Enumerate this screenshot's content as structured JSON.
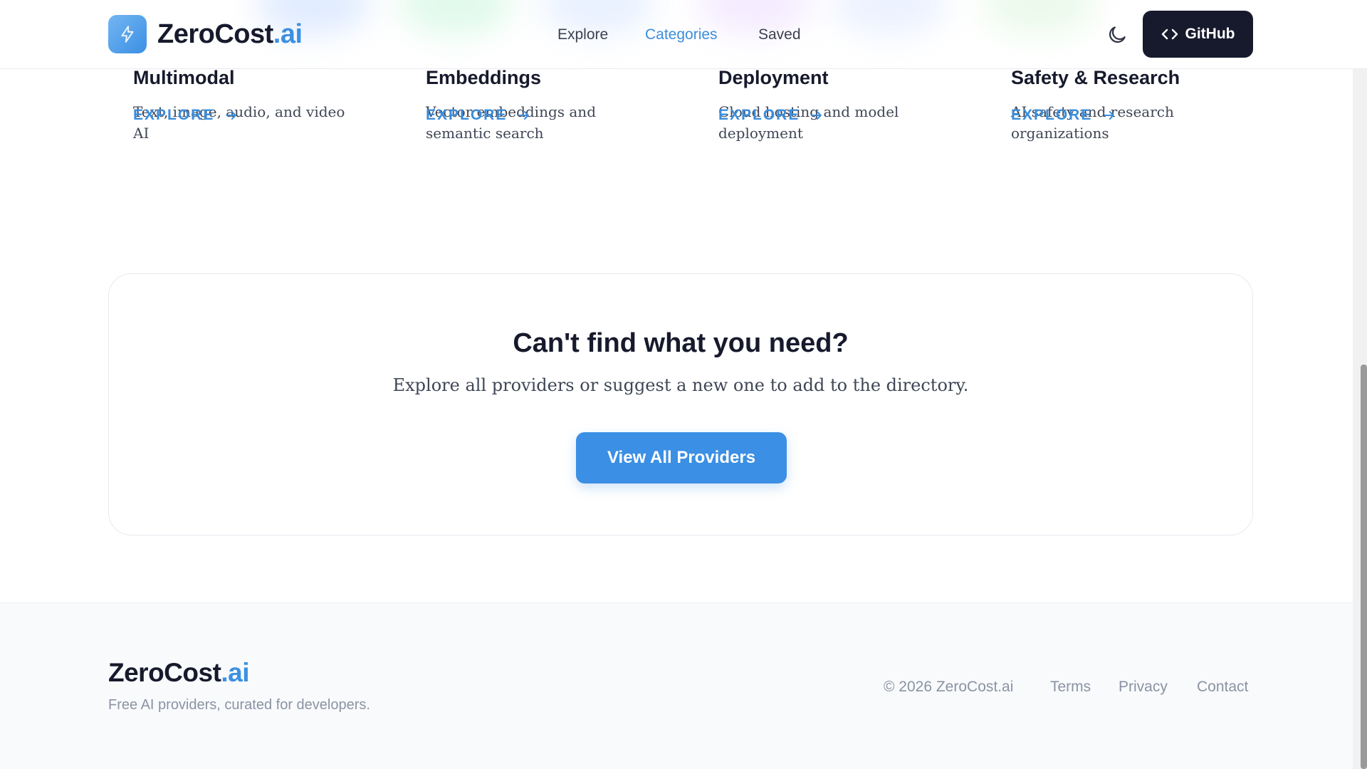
{
  "header": {
    "logo_main": "ZeroCost",
    "logo_accent": ".ai",
    "nav": [
      {
        "label": "Explore",
        "active": false
      },
      {
        "label": "Categories",
        "active": true
      },
      {
        "label": "Saved",
        "active": false
      }
    ],
    "theme_icon": "moon-icon",
    "github_label": "GitHub",
    "github_icon": "code-icon"
  },
  "categories": [
    {
      "title": "Multimodal",
      "description": "Text, image, audio, and video AI",
      "cta": "EXPLORE"
    },
    {
      "title": "Embeddings",
      "description": "Vector embeddings and semantic search",
      "cta": "EXPLORE"
    },
    {
      "title": "Deployment",
      "description": "Cloud hosting and model deployment",
      "cta": "EXPLORE"
    },
    {
      "title": "Safety & Research",
      "description": "AI safety and research organizations",
      "cta": "EXPLORE"
    }
  ],
  "cta": {
    "title": "Can't find what you need?",
    "text": "Explore all providers or suggest a new one to add to the directory.",
    "button": "View All Providers"
  },
  "footer": {
    "brand_main": "ZeroCost",
    "brand_accent": ".ai",
    "tagline": "Free AI providers, curated for developers.",
    "copyright": "© 2026 ZeroCost.ai",
    "links": [
      "Terms",
      "Privacy",
      "Contact"
    ]
  },
  "colors": {
    "accent": "#3b90e2",
    "dark": "#171a2c",
    "muted": "#8b93a3",
    "footer_bg": "#f8fafc"
  }
}
